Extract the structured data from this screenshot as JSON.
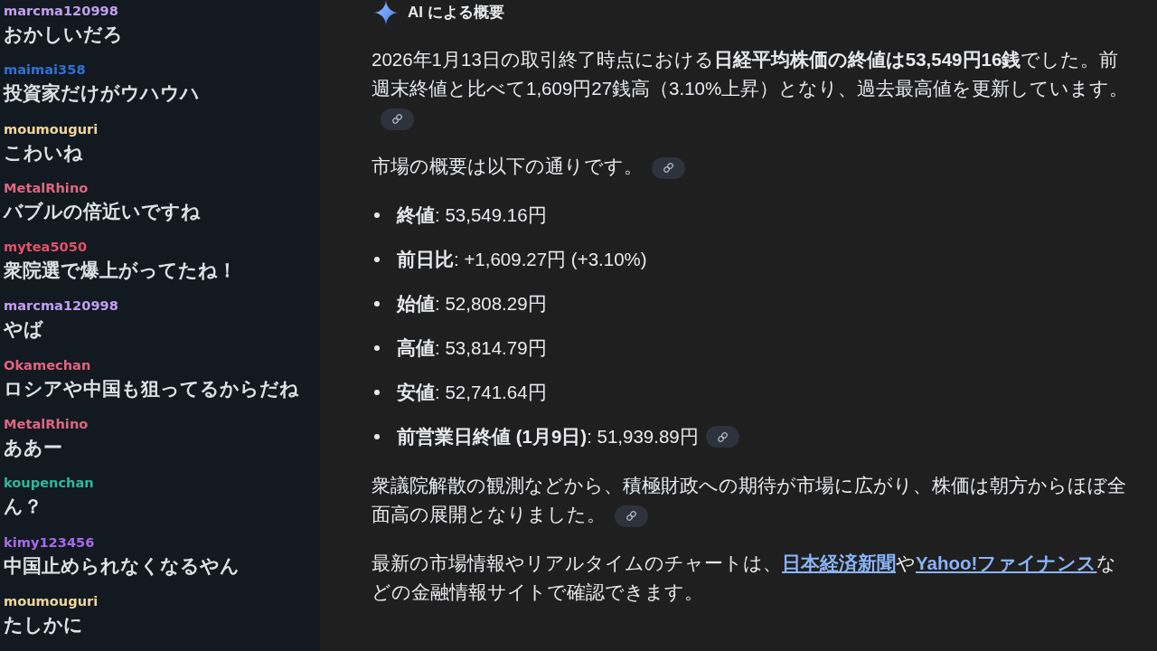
{
  "chat": {
    "messages": [
      {
        "user": "marcma120998",
        "color": "#c39ef0",
        "text": "おかしいだろ"
      },
      {
        "user": "maimai358",
        "color": "#2f72d4",
        "text": "投資家だけがウハウハ"
      },
      {
        "user": "moumouguri",
        "color": "#f2d59a",
        "text": "こわいね"
      },
      {
        "user": "MetalRhino",
        "color": "#e06680",
        "text": "バブルの倍近いですね"
      },
      {
        "user": "mytea5050",
        "color": "#e4506a",
        "text": "衆院選で爆上がってたね！"
      },
      {
        "user": "marcma120998",
        "color": "#c39ef0",
        "text": "やば"
      },
      {
        "user": "Okamechan",
        "color": "#e0647c",
        "text": "ロシアや中国も狙ってるからだね"
      },
      {
        "user": "MetalRhino",
        "color": "#e06680",
        "text": "ああー"
      },
      {
        "user": "koupenchan",
        "color": "#2fb89a",
        "text": "ん？"
      },
      {
        "user": "kimy123456",
        "color": "#a66be8",
        "text": "中国止められなくなるやん"
      },
      {
        "user": "moumouguri",
        "color": "#f2d59a",
        "text": "たしかに"
      }
    ]
  },
  "ai_overview": {
    "title": "AI による概要",
    "blocks": [
      {
        "kind": "paragraph",
        "segments": [
          {
            "kind": "text",
            "text": "2026年1月13日の取引終了時点における**日経平均株価の終値は53,549円16銭**でした。前週末終値と比べて1,609円27銭高（3.10%上昇）となり、過去最高値を更新しています。"
          }
        ],
        "source_chip": true
      },
      {
        "kind": "paragraph",
        "segments": [
          {
            "kind": "text",
            "text": "市場の概要は以下の通りです。"
          }
        ],
        "source_chip": true
      },
      {
        "kind": "list",
        "items": [
          {
            "text": "**終値**: 53,549.16円",
            "source_chip": false
          },
          {
            "text": "**前日比**: +1,609.27円 (+3.10%)",
            "source_chip": false
          },
          {
            "text": "**始値**: 52,808.29円",
            "source_chip": false
          },
          {
            "text": "**高値**: 53,814.79円",
            "source_chip": false
          },
          {
            "text": "**安値**: 52,741.64円",
            "source_chip": false
          },
          {
            "text": "**前営業日終値 (1月9日)**: 51,939.89円",
            "source_chip": true
          }
        ]
      },
      {
        "kind": "paragraph",
        "segments": [
          {
            "kind": "text",
            "text": "衆議院解散の観測などから、積極財政への期待が市場に広がり、株価は朝方からほぼ全面高の展開となりました。"
          }
        ],
        "source_chip": true
      },
      {
        "kind": "paragraph",
        "segments": [
          {
            "kind": "text",
            "text": "最新の市場情報やリアルタイムのチャートは、"
          },
          {
            "kind": "link",
            "text": "日本経済新聞"
          },
          {
            "kind": "text",
            "text": "や"
          },
          {
            "kind": "link",
            "text": "Yahoo!ファイナンス"
          },
          {
            "kind": "text",
            "text": "などの金融情報サイトで確認できます。"
          }
        ],
        "source_chip": false
      }
    ]
  }
}
